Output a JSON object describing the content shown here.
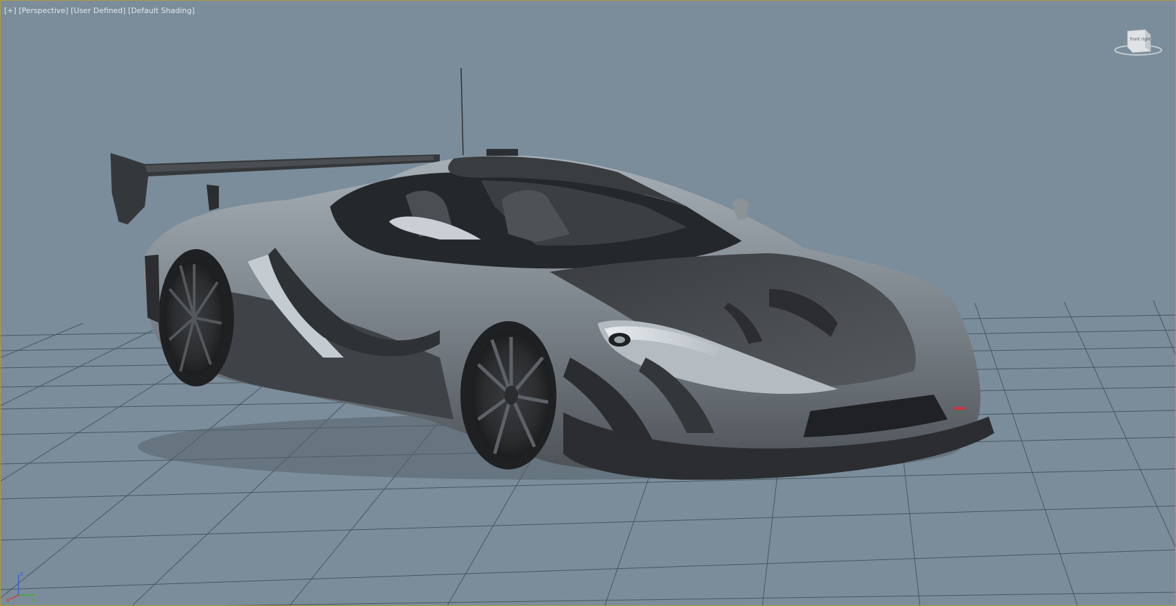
{
  "viewport": {
    "labels": {
      "plus": "[+]",
      "view": "[Perspective]",
      "mode": "[User Defined]",
      "shading": "[Default Shading]"
    },
    "viewcube_face_label": "front  right",
    "axis": {
      "x": "x",
      "y": "y",
      "z": "z"
    },
    "colors": {
      "background": "#7b8d9a",
      "grid": "#3f4b55",
      "border": "#b09a3a",
      "body_light": "#8f979e",
      "body_dark": "#3e4246"
    },
    "object": "car-model"
  }
}
